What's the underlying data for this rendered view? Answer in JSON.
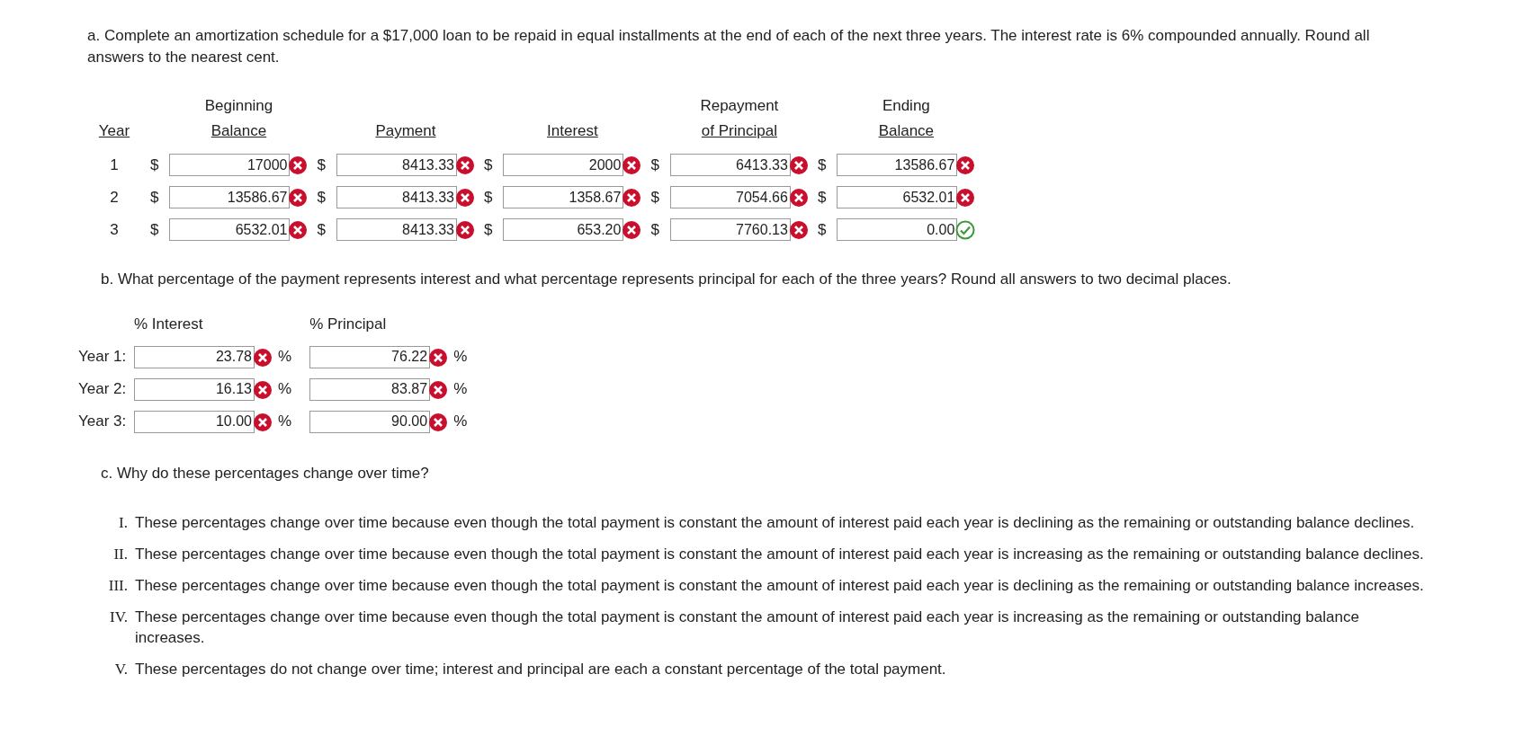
{
  "part_a": {
    "prompt": "a. Complete an amortization schedule for a $17,000 loan to be repaid in equal installments at the end of each of the next three years. The interest rate is 6% compounded annually. Round all answers to the nearest cent.",
    "columns": [
      {
        "lines": [
          "Year"
        ]
      },
      {
        "lines": [
          "Beginning",
          "Balance"
        ]
      },
      {
        "lines": [
          "Payment"
        ]
      },
      {
        "lines": [
          "Interest"
        ]
      },
      {
        "lines": [
          "Repayment",
          "of Principal"
        ]
      },
      {
        "lines": [
          "Ending",
          "Balance"
        ]
      }
    ],
    "rows": [
      {
        "year": "1",
        "cells": [
          {
            "currency": "$",
            "value": "17000",
            "correct": false
          },
          {
            "currency": "$",
            "value": "8413.33",
            "correct": false
          },
          {
            "currency": "$",
            "value": "2000",
            "correct": false
          },
          {
            "currency": "$",
            "value": "6413.33",
            "correct": false
          },
          {
            "currency": "$",
            "value": "13586.67",
            "correct": false
          }
        ]
      },
      {
        "year": "2",
        "cells": [
          {
            "currency": "$",
            "value": "13586.67",
            "correct": false
          },
          {
            "currency": "$",
            "value": "8413.33",
            "correct": false
          },
          {
            "currency": "$",
            "value": "1358.67",
            "correct": false
          },
          {
            "currency": "$",
            "value": "7054.66",
            "correct": false
          },
          {
            "currency": "$",
            "value": "6532.01",
            "correct": false
          }
        ]
      },
      {
        "year": "3",
        "cells": [
          {
            "currency": "$",
            "value": "6532.01",
            "correct": false
          },
          {
            "currency": "$",
            "value": "8413.33",
            "correct": false
          },
          {
            "currency": "$",
            "value": "653.20",
            "correct": false
          },
          {
            "currency": "$",
            "value": "7760.13",
            "correct": false
          },
          {
            "currency": "$",
            "value": "0.00",
            "correct": true
          }
        ]
      }
    ]
  },
  "part_b": {
    "prompt": "b. What percentage of the payment represents interest and what percentage represents principal for each of the three years? Round all answers to two decimal places.",
    "columns": [
      "% Interest",
      "% Principal"
    ],
    "rows": [
      {
        "label": "Year 1:",
        "cells": [
          {
            "value": "23.78",
            "unit": "%",
            "correct": false
          },
          {
            "value": "76.22",
            "unit": "%",
            "correct": false
          }
        ]
      },
      {
        "label": "Year 2:",
        "cells": [
          {
            "value": "16.13",
            "unit": "%",
            "correct": false
          },
          {
            "value": "83.87",
            "unit": "%",
            "correct": false
          }
        ]
      },
      {
        "label": "Year 3:",
        "cells": [
          {
            "value": "10.00",
            "unit": "%",
            "correct": false
          },
          {
            "value": "90.00",
            "unit": "%",
            "correct": false
          }
        ]
      }
    ]
  },
  "part_c": {
    "prompt": "c. Why do these percentages change over time?",
    "options": [
      {
        "numeral": "I.",
        "text": "These percentages change over time because even though the total payment is constant the amount of interest paid each year is declining as the remaining or outstanding balance declines."
      },
      {
        "numeral": "II.",
        "text": "These percentages change over time because even though the total payment is constant the amount of interest paid each year is increasing as the remaining or outstanding balance declines."
      },
      {
        "numeral": "III.",
        "text": "These percentages change over time because even though the total payment is constant the amount of interest paid each year is declining as the remaining or outstanding balance increases."
      },
      {
        "numeral": "IV.",
        "text": "These percentages change over time because even though the total payment is constant the amount of interest paid each year is increasing as the remaining or outstanding balance increases."
      },
      {
        "numeral": "V.",
        "text": "These percentages do not change over time; interest and principal are each a constant percentage of the total payment."
      }
    ]
  }
}
